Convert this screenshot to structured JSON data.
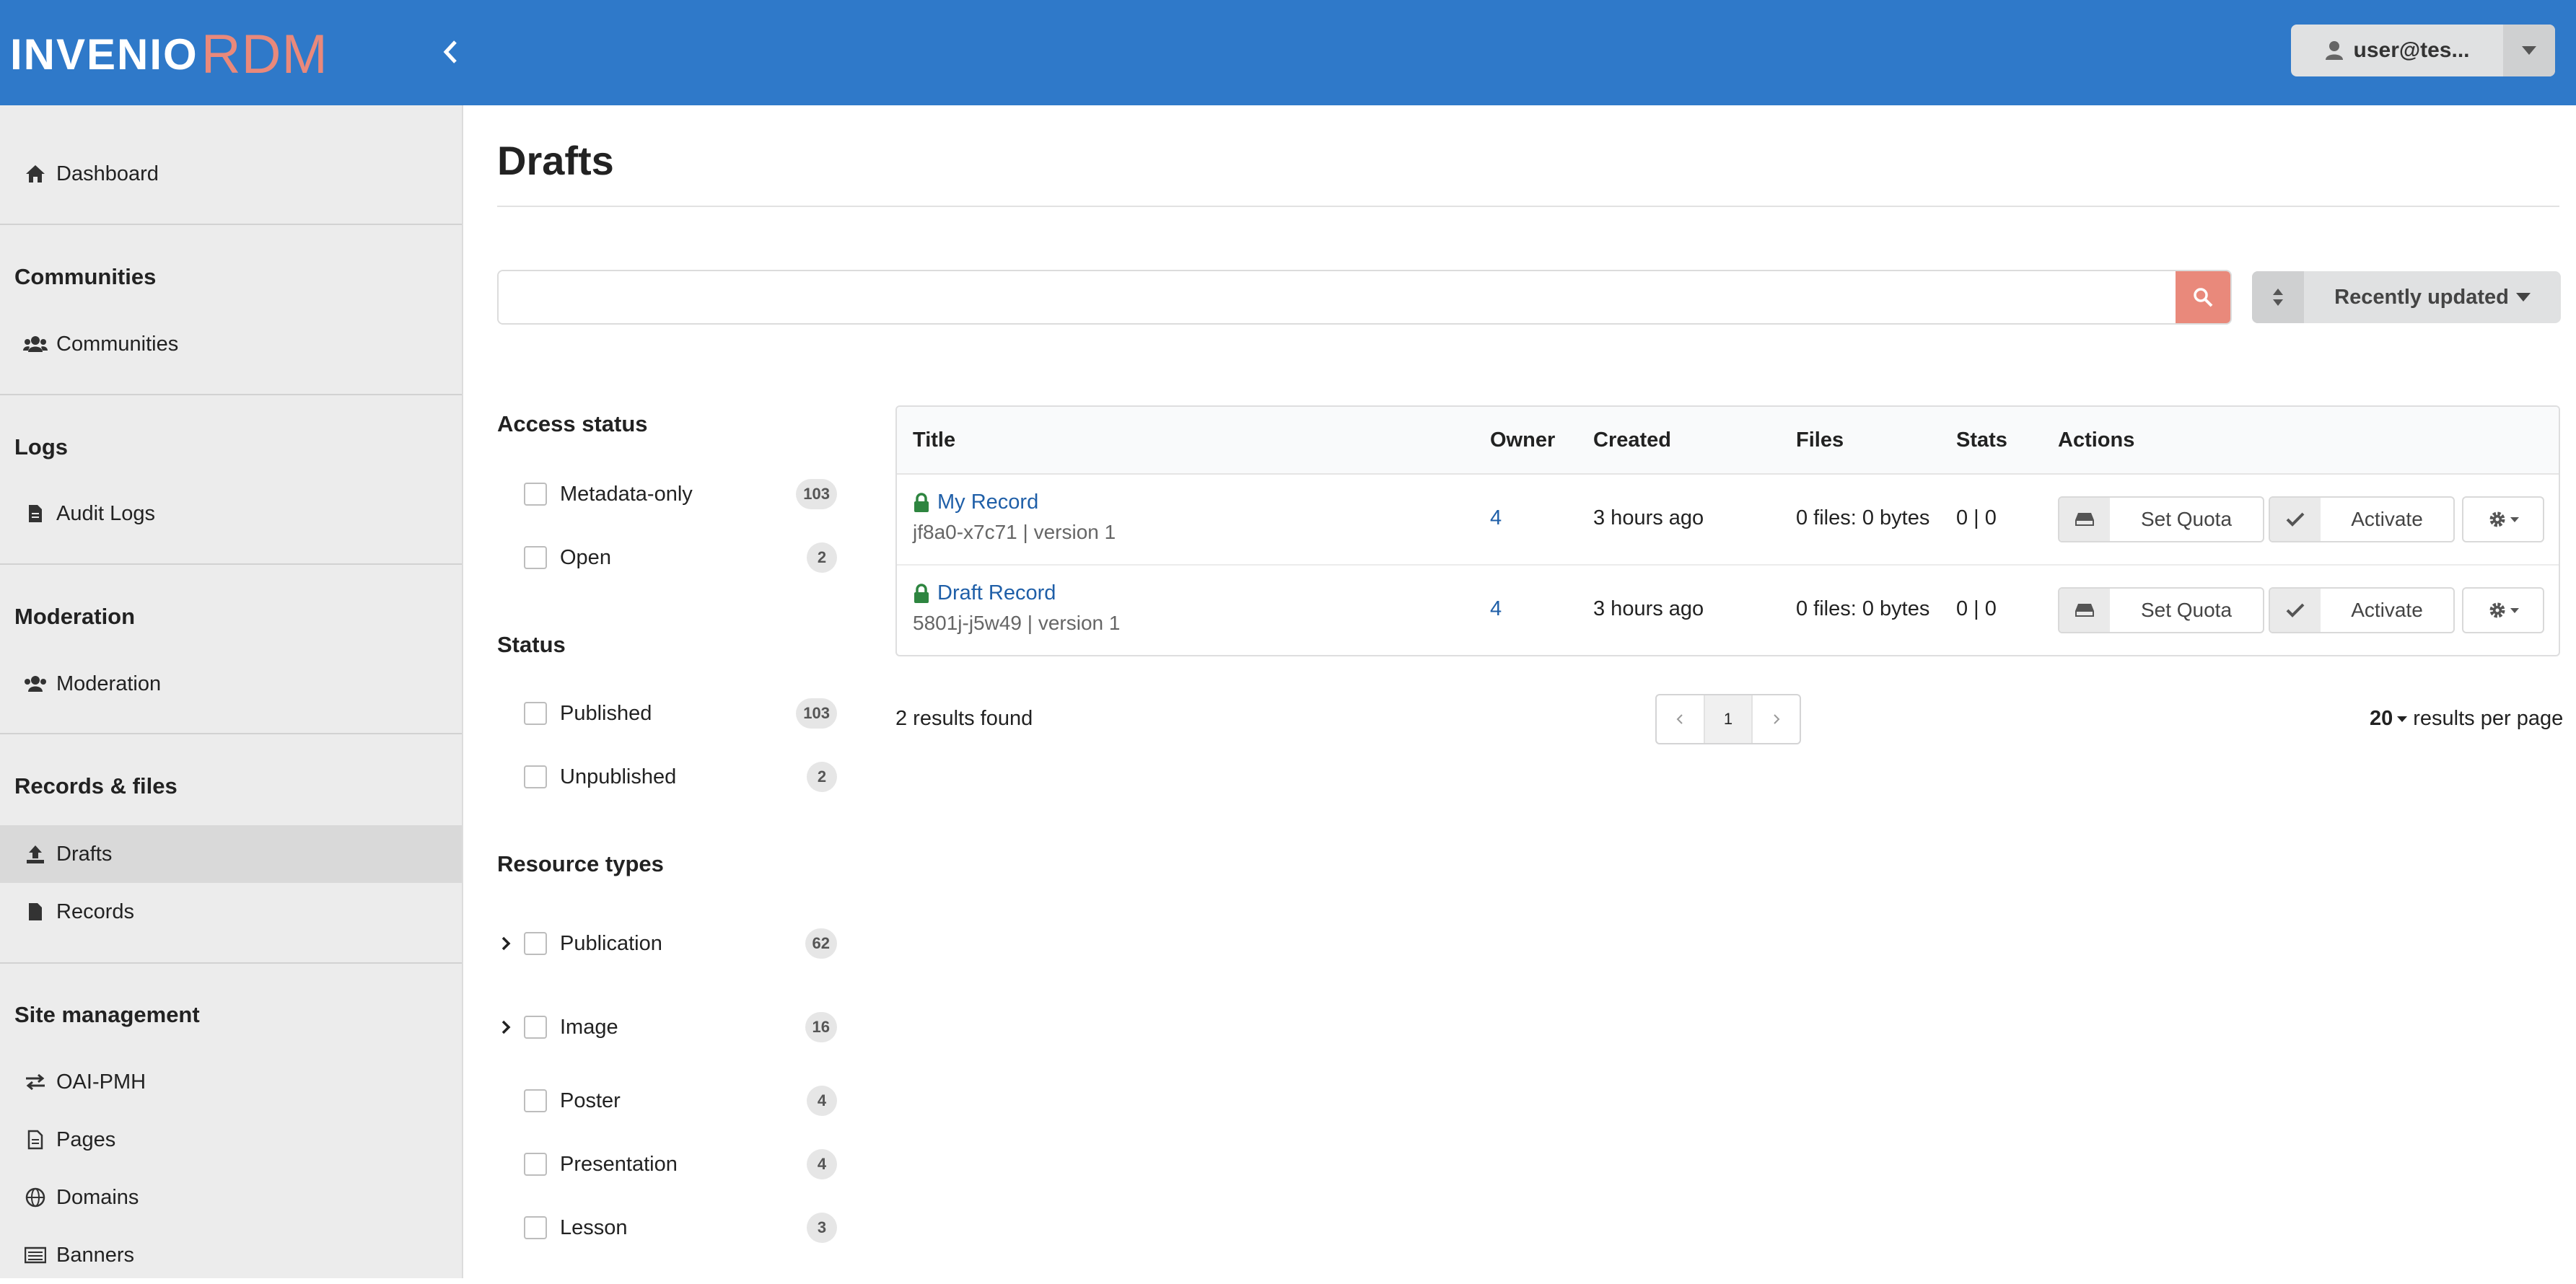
{
  "header": {
    "logo_main": "INVENIO",
    "logo_accent": "RDM",
    "user_label": "user@tes..."
  },
  "sidebar": {
    "dashboard": "Dashboard",
    "sections": [
      {
        "title": "Communities",
        "items": [
          "Communities"
        ]
      },
      {
        "title": "Logs",
        "items": [
          "Audit Logs"
        ]
      },
      {
        "title": "Moderation",
        "items": [
          "Moderation"
        ]
      },
      {
        "title": "Records & files",
        "items": [
          "Drafts",
          "Records"
        ]
      },
      {
        "title": "Site management",
        "items": [
          "OAI-PMH",
          "Pages",
          "Domains",
          "Banners"
        ]
      }
    ],
    "active_item": "Drafts"
  },
  "main": {
    "title": "Drafts",
    "search": {
      "value": "",
      "placeholder": ""
    },
    "sort_label": "Recently updated"
  },
  "facets": {
    "access_status": {
      "title": "Access status",
      "items": [
        {
          "label": "Metadata-only",
          "count": "103"
        },
        {
          "label": "Open",
          "count": "2"
        }
      ]
    },
    "status": {
      "title": "Status",
      "items": [
        {
          "label": "Published",
          "count": "103"
        },
        {
          "label": "Unpublished",
          "count": "2"
        }
      ]
    },
    "resource_types": {
      "title": "Resource types",
      "items": [
        {
          "label": "Publication",
          "count": "62"
        },
        {
          "label": "Image",
          "count": "16"
        },
        {
          "label": "Poster",
          "count": "4"
        },
        {
          "label": "Presentation",
          "count": "4"
        },
        {
          "label": "Lesson",
          "count": "3"
        }
      ]
    }
  },
  "table": {
    "headers": [
      "Title",
      "Owner",
      "Created",
      "Files",
      "Stats",
      "Actions"
    ],
    "rows": [
      {
        "title": "My Record",
        "subtitle": "jf8a0-x7c71 | version 1",
        "owner": "4",
        "created": "3 hours ago",
        "files": "0 files: 0 bytes",
        "stats": "0 | 0"
      },
      {
        "title": "Draft Record",
        "subtitle": "5801j-j5w49 | version 1",
        "owner": "4",
        "created": "3 hours ago",
        "files": "0 files: 0 bytes",
        "stats": "0 | 0"
      }
    ],
    "actions": {
      "quota": "Set Quota",
      "activate": "Activate"
    }
  },
  "results": {
    "count_text": "2 results found",
    "current_page": "1",
    "per_page_value": "20",
    "per_page_text": "results per page"
  },
  "colors": {
    "header_bg": "#2f79c9",
    "accent": "#e9897b",
    "link": "#1f5fa8",
    "lock": "#2e8540"
  }
}
